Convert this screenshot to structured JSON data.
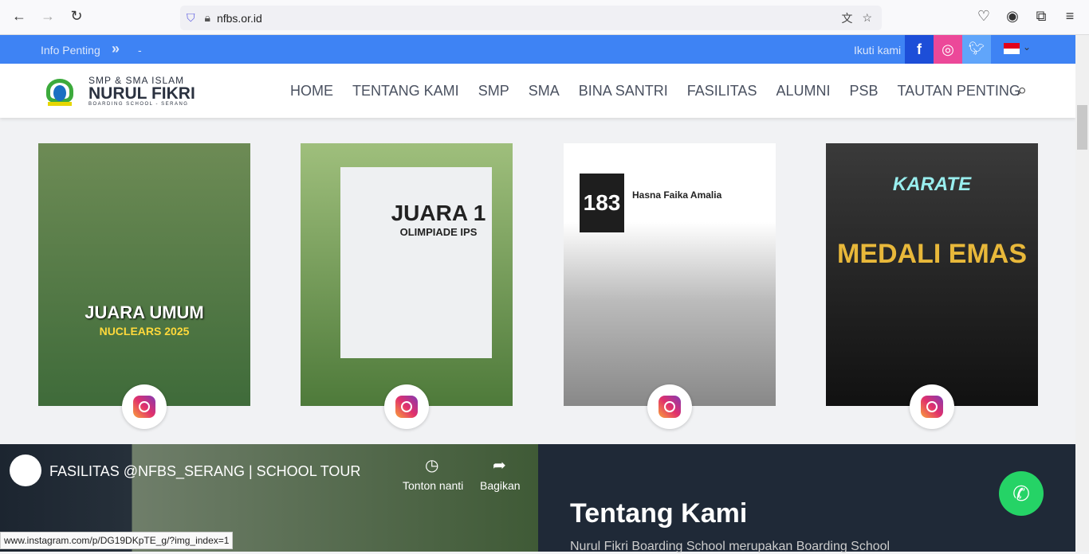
{
  "browser": {
    "url": "nfbs.or.id"
  },
  "topbar": {
    "info_label": "Info Penting",
    "info_text": "-",
    "follow_label": "Ikuti kami"
  },
  "logo": {
    "line1": "SMP & SMA ISLAM",
    "line2": "NURUL FIKRI",
    "line3": "BOARDING SCHOOL - SERANG"
  },
  "nav": {
    "items": [
      "HOME",
      "TENTANG KAMI",
      "SMP",
      "SMA",
      "BINA SANTRI",
      "FASILITAS",
      "ALUMNI",
      "PSB",
      "TAUTAN PENTING"
    ]
  },
  "posts": [
    {
      "title": "JUARA UMUM",
      "sub": "NUCLEARS 2025",
      "bg": "#3f6b3a"
    },
    {
      "title": "JUARA 1",
      "sub": "OLIMPIADE IPS",
      "bg": "#6b8f4e"
    },
    {
      "title": "Hasna Faika Amalia",
      "sub": "183",
      "bg": "#d8d8d8"
    },
    {
      "title": "MEDALI EMAS",
      "sub": "KARATE",
      "bg": "#1d1d1d"
    }
  ],
  "video": {
    "title": "FASILITAS @NFBS_SERANG | SCHOOL TOUR",
    "watch_later": "Tonton nanti",
    "share": "Bagikan"
  },
  "about": {
    "heading": "Tentang Kami",
    "text": "Nurul Fikri Boarding School merupakan Boarding School"
  },
  "status_url": "www.instagram.com/p/DG19DKpTE_g/?img_index=1",
  "colors": {
    "topbar": "#3e83f4",
    "facebook": "#1d4ed8",
    "instagram": "#ec4899",
    "twitter": "#60a5fa",
    "about_bg": "#1f2937",
    "whatsapp": "#25d366"
  }
}
